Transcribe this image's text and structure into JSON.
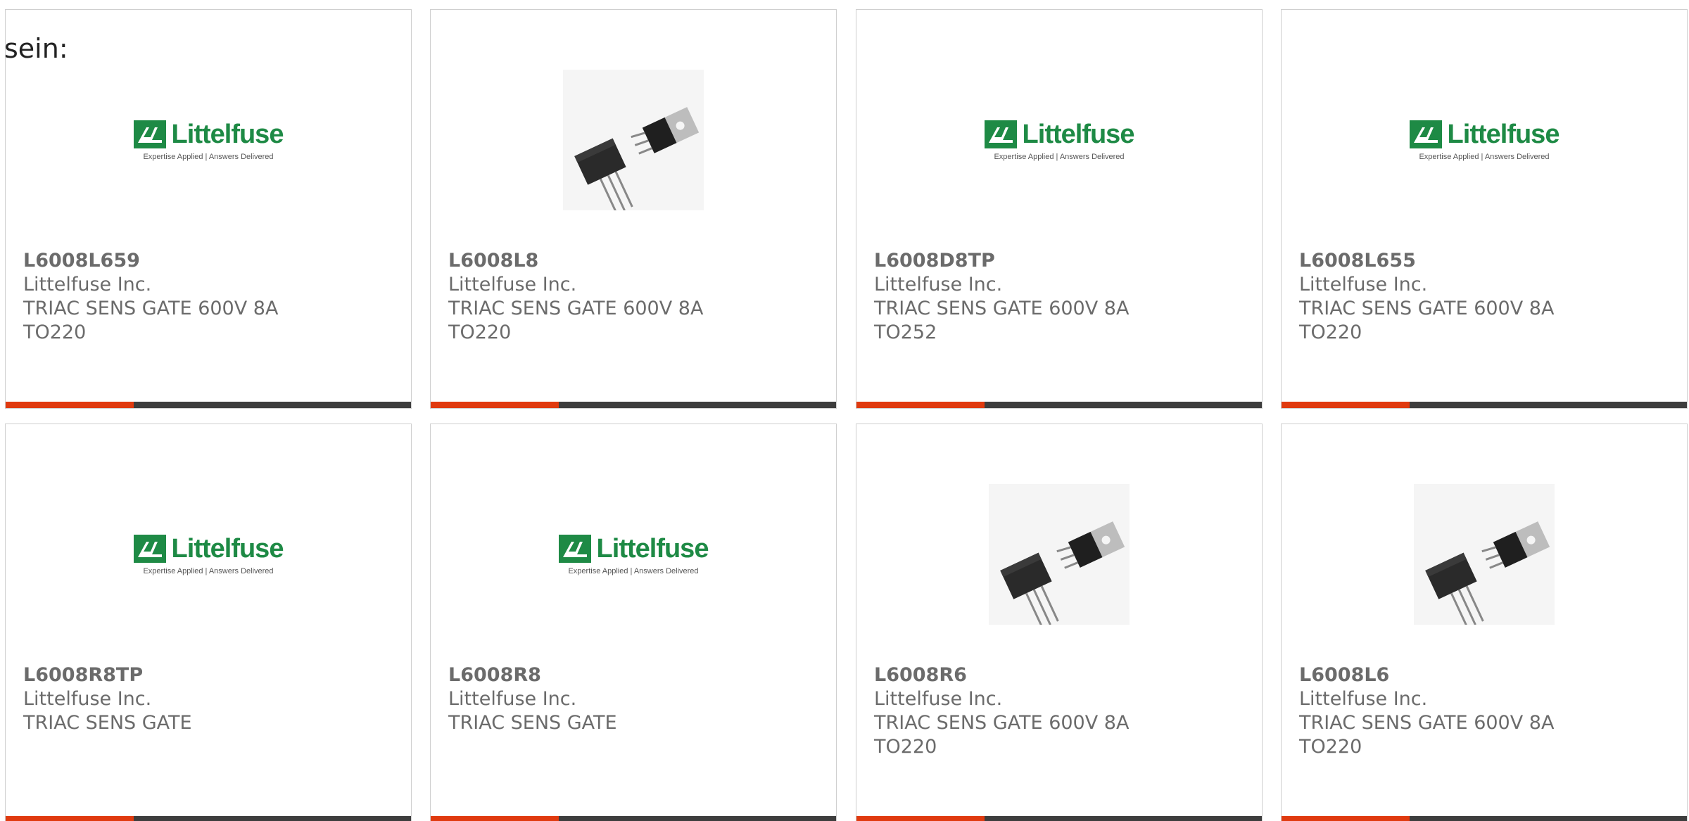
{
  "intro_text": "sein:",
  "brand": {
    "logo_word": "Littelfuse",
    "logo_tagline": "Expertise Applied | Answers Delivered",
    "accent_color": "#e03a0f",
    "logo_color": "#1e8a45"
  },
  "products": [
    {
      "part": "L6008L659",
      "manufacturer": "Littelfuse Inc.",
      "description": "TRIAC SENS GATE 600V 8A TO220",
      "image": "littelfuse-logo"
    },
    {
      "part": "L6008L8",
      "manufacturer": "Littelfuse Inc.",
      "description": "TRIAC SENS GATE 600V 8A TO220",
      "image": "to220-photo"
    },
    {
      "part": "L6008D8TP",
      "manufacturer": "Littelfuse Inc.",
      "description": "TRIAC SENS GATE 600V 8A TO252",
      "image": "littelfuse-logo"
    },
    {
      "part": "L6008L655",
      "manufacturer": "Littelfuse Inc.",
      "description": "TRIAC SENS GATE 600V 8A TO220",
      "image": "littelfuse-logo"
    },
    {
      "part": "L6008R8TP",
      "manufacturer": "Littelfuse Inc.",
      "description": "TRIAC SENS GATE",
      "image": "littelfuse-logo"
    },
    {
      "part": "L6008R8",
      "manufacturer": "Littelfuse Inc.",
      "description": "TRIAC SENS GATE",
      "image": "littelfuse-logo"
    },
    {
      "part": "L6008R6",
      "manufacturer": "Littelfuse Inc.",
      "description": "TRIAC SENS GATE 600V 8A TO220",
      "image": "to220-photo"
    },
    {
      "part": "L6008L6",
      "manufacturer": "Littelfuse Inc.",
      "description": "TRIAC SENS GATE 600V 8A TO220",
      "image": "to220-photo"
    }
  ]
}
